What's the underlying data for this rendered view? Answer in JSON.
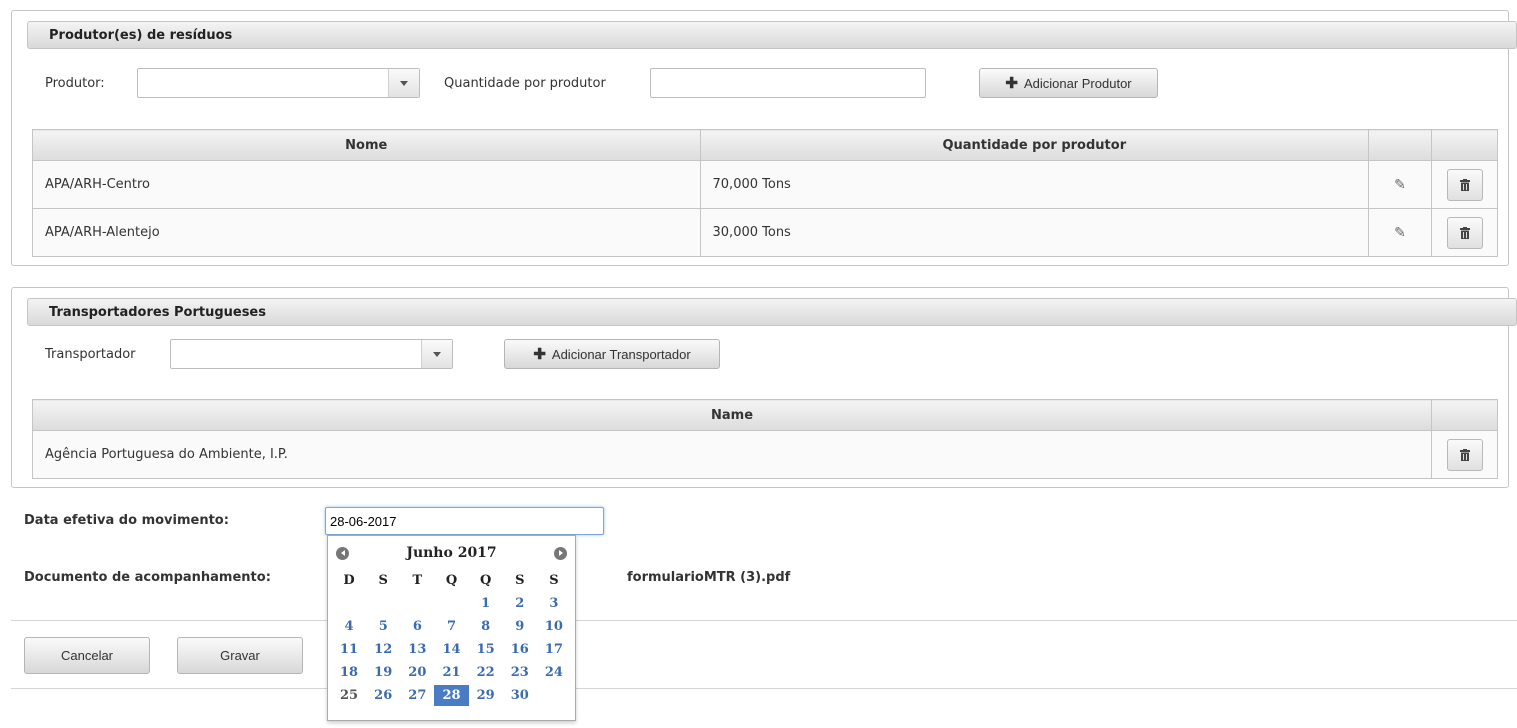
{
  "produtores": {
    "title": "Produtor(es) de resíduos",
    "produtor_label": "Produtor:",
    "quantidade_label": "Quantidade por produtor",
    "add_label": "Adicionar Produtor",
    "table": {
      "headers": [
        "Nome",
        "Quantidade por produtor"
      ],
      "rows": [
        {
          "nome": "APA/ARH-Centro",
          "quantidade": "70,000  Tons"
        },
        {
          "nome": "APA/ARH-Alentejo",
          "quantidade": "30,000  Tons"
        }
      ]
    }
  },
  "transportadores": {
    "title": "Transportadores Portugueses",
    "transportador_label": "Transportador",
    "add_label": "Adicionar Transportador",
    "table": {
      "headers": [
        "Name"
      ],
      "rows": [
        {
          "name": "Agência Portuguesa do Ambiente, I.P."
        }
      ]
    }
  },
  "form": {
    "data_label": "Data efetiva do movimento:",
    "data_value": "28-06-2017",
    "doc_label": "Documento de acompanhamento:",
    "doc_file": "formularioMTR (3).pdf"
  },
  "buttons": {
    "cancel": "Cancelar",
    "save": "Gravar"
  },
  "calendar": {
    "month_label": "Junho 2017",
    "weekdays": [
      "D",
      "S",
      "T",
      "Q",
      "Q",
      "S",
      "S"
    ],
    "first_weekday_index": 4,
    "days_in_month": 30,
    "today": 25,
    "selected": 28,
    "accent_color": "#4a7cc4"
  },
  "icons": {
    "plus": "plus-icon",
    "edit": "pencil-icon",
    "delete": "trash-icon",
    "dropdown": "chevron-down-icon",
    "prev": "prev-month-icon",
    "next": "next-month-icon"
  }
}
